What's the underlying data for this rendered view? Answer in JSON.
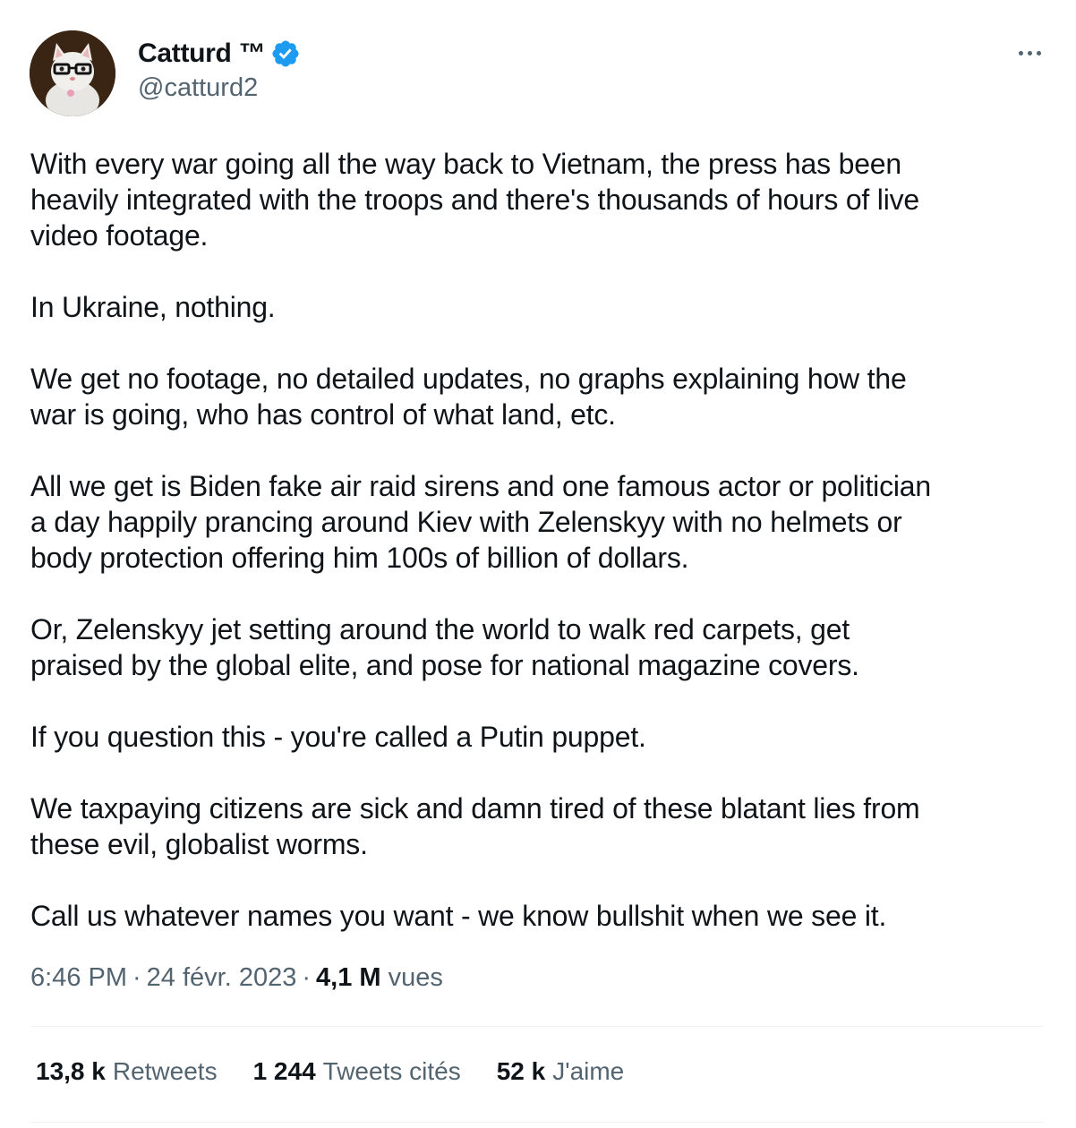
{
  "author": {
    "display_name": "Catturd ™",
    "handle": "@catturd2",
    "verified": true,
    "avatar_icon": "cat-with-glasses-avatar"
  },
  "tweet": {
    "paragraphs": [
      "With every war going all the way back to Vietnam, the press has been\nheavily integrated with the troops and there's thousands of hours of live\nvideo footage.",
      "In Ukraine, nothing.",
      "We get no footage, no detailed updates, no graphs explaining how the\nwar is going, who has control of what land, etc.",
      "All we get is Biden fake air raid sirens and one famous actor or politician\na day happily prancing around Kiev with Zelenskyy with no helmets or\nbody protection offering him 100s of billion of dollars.",
      "Or, Zelenskyy jet setting around the world to walk red carpets, get\npraised by the global elite, and pose for national magazine covers.",
      "If you question this - you're called a Putin puppet.",
      "We taxpaying citizens are sick and damn tired of these blatant lies from\nthese evil, globalist worms.",
      "Call us whatever names you want - we know bullshit when we see it."
    ]
  },
  "meta": {
    "time": "6:46 PM",
    "separator": "·",
    "date": "24 févr. 2023",
    "views_count": "4,1 M",
    "views_label": "vues"
  },
  "stats": {
    "retweets_count": "13,8 k",
    "retweets_label": "Retweets",
    "quotes_count": "1 244",
    "quotes_label": "Tweets cités",
    "likes_count": "52 k",
    "likes_label": "J'aime"
  },
  "colors": {
    "text": "#0f1419",
    "secondary": "#536471",
    "verified": "#1d9bf0",
    "divider": "#eff3f4"
  }
}
